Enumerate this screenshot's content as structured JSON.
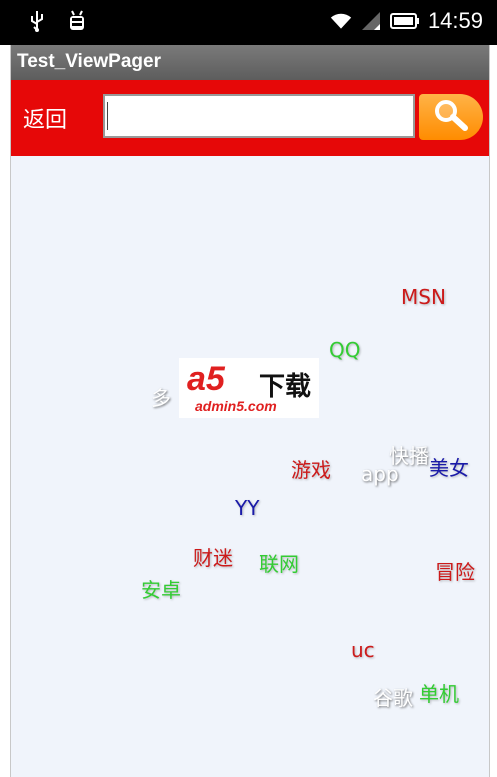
{
  "status_bar": {
    "time": "14:59",
    "icons": [
      "usb-icon",
      "debug-icon",
      "wifi-icon",
      "signal-icon",
      "battery-icon"
    ]
  },
  "app": {
    "title": "Test_ViewPager"
  },
  "header": {
    "back_label": "返回",
    "search_value": "",
    "search_icon": "search-icon",
    "accent_color": "#e60808"
  },
  "cloud": {
    "tags": [
      {
        "text": "MSN",
        "color": "red"
      },
      {
        "text": "QQ",
        "color": "green"
      },
      {
        "text": "多",
        "color": "white"
      },
      {
        "text": "快播",
        "color": "white"
      },
      {
        "text": "游戏",
        "color": "red"
      },
      {
        "text": "app",
        "color": "white"
      },
      {
        "text": "美女",
        "color": "blue"
      },
      {
        "text": "YY",
        "color": "blue"
      },
      {
        "text": "财迷",
        "color": "red"
      },
      {
        "text": "联网",
        "color": "green"
      },
      {
        "text": "冒险",
        "color": "red"
      },
      {
        "text": "安卓",
        "color": "green"
      },
      {
        "text": "uc",
        "color": "red"
      },
      {
        "text": "谷歌",
        "color": "white"
      },
      {
        "text": "单机",
        "color": "green"
      }
    ]
  },
  "watermark": {
    "logo_text": "a5",
    "cn_text": "下载",
    "url": "admin5.com"
  }
}
